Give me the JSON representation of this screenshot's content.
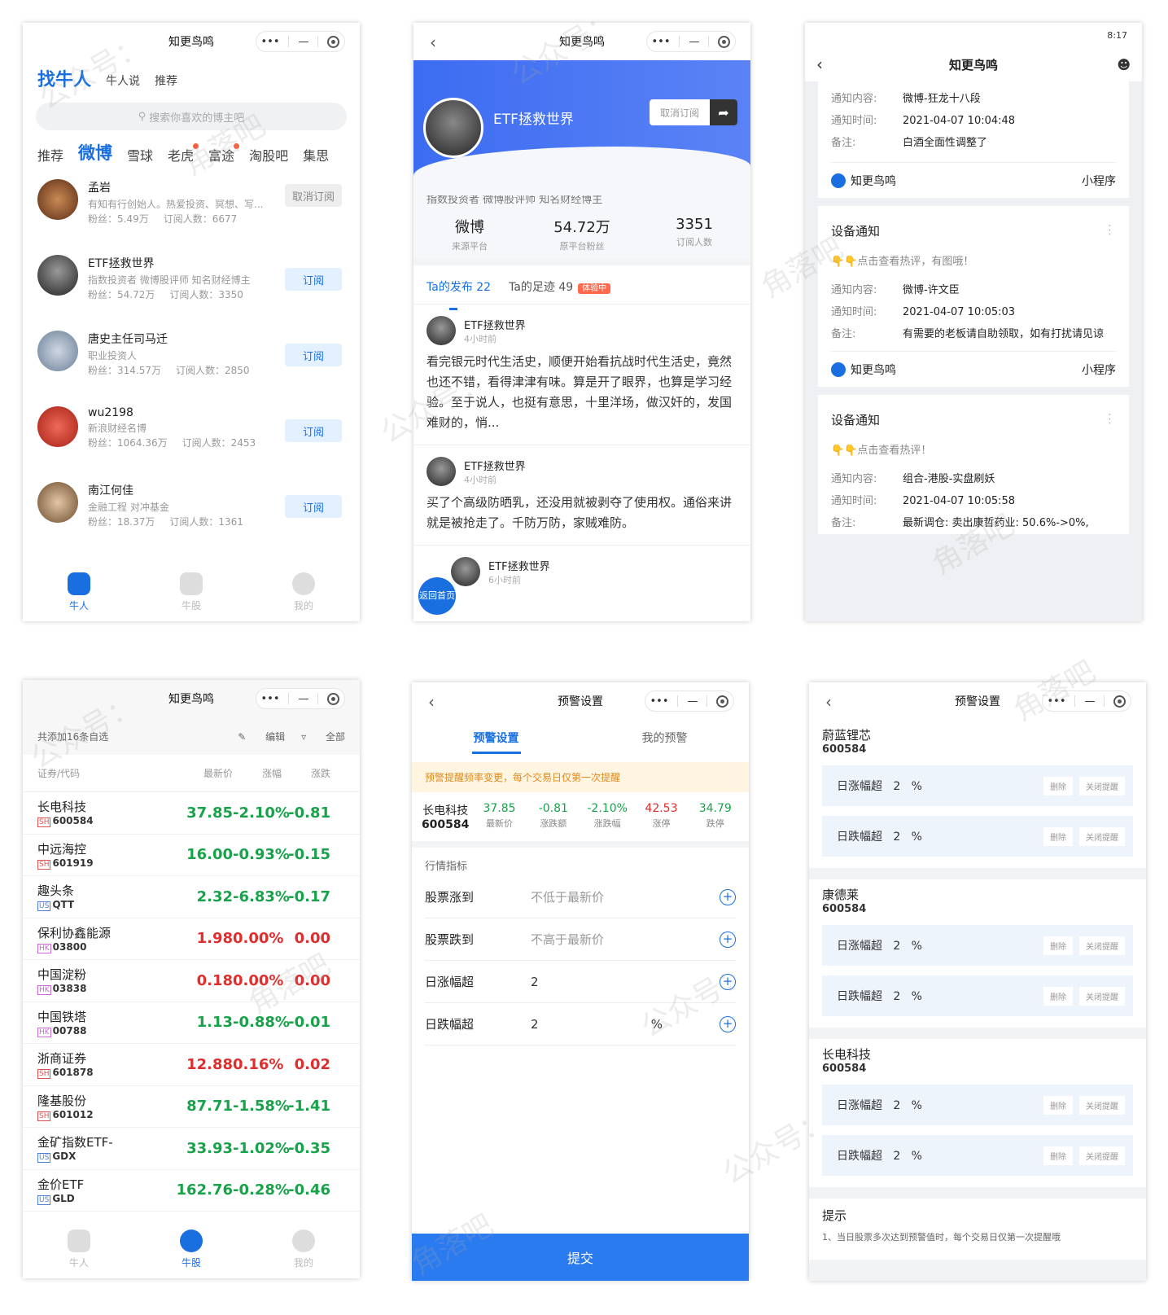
{
  "app_title": "知更鸟鸣",
  "capsule": {
    "dots": "•••",
    "minus": "—"
  },
  "p1": {
    "header": {
      "main": "找牛人",
      "tab2": "牛人说",
      "tab3": "推荐"
    },
    "search_placeholder": "搜索你喜欢的博主吧",
    "tabs": [
      "推荐",
      "微博",
      "雪球",
      "老虎",
      "富途",
      "淘股吧",
      "集思"
    ],
    "users": [
      {
        "name": "孟岩",
        "desc": "有知有行创始人。热爱投资、冥想、写...",
        "fans": "粉丝：5.49万",
        "subs": "订阅人数：6677",
        "btn": "取消订阅"
      },
      {
        "name": "ETF拯救世界",
        "desc": "指数投资者 微博股评师 知名财经博主",
        "fans": "粉丝：54.72万",
        "subs": "订阅人数：3350",
        "btn": "订阅"
      },
      {
        "name": "唐史主任司马迁",
        "desc": "职业投资人",
        "fans": "粉丝：314.57万",
        "subs": "订阅人数：2850",
        "btn": "订阅"
      },
      {
        "name": "wu2198",
        "desc": "新浪财经名博",
        "fans": "粉丝：1064.36万",
        "subs": "订阅人数：2453",
        "btn": "订阅"
      },
      {
        "name": "南江何佳",
        "desc": "金融工程 对冲基金",
        "fans": "粉丝：18.37万",
        "subs": "订阅人数：1361",
        "btn": "订阅"
      }
    ],
    "tabbar": [
      "牛人",
      "牛股",
      "我的"
    ]
  },
  "p2": {
    "name": "ETF拯救世界",
    "unsub": "取消订阅",
    "bio": "指数投资者 微博股评师 知名财经博主",
    "stats": [
      {
        "v": "微博",
        "l": "来源平台"
      },
      {
        "v": "54.72万",
        "l": "原平台粉丝"
      },
      {
        "v": "3351",
        "l": "订阅人数"
      }
    ],
    "tab_posts": "Ta的发布 22",
    "tab_trace": "Ta的足迹 49",
    "trial_tag": "体验中",
    "posts": [
      {
        "name": "ETF拯救世界",
        "time": "4小时前",
        "text": "看完银元时代生活史，顺便开始看抗战时代生活史，竟然也还不错，看得津津有味。算是开了眼界，也算是学习经验。至于说人，也挺有意思，十里洋场，做汉奸的，发国难财的，悄..."
      },
      {
        "name": "ETF拯救世界",
        "time": "4小时前",
        "text": "买了个高级防晒乳，还没用就被剥夺了使用权。通俗来讲就是被抢走了。千防万防，家贼难防。"
      },
      {
        "name": "ETF拯救世界",
        "time": "6小时前",
        "text": ""
      }
    ],
    "home_btn": "返回首页"
  },
  "p3": {
    "status_time": "8:17",
    "title": "知更鸟鸣",
    "labels": {
      "content": "通知内容:",
      "time": "通知时间:",
      "remark": "备注:"
    },
    "footer_app": "知更鸟鸣",
    "footer_mini": "小程序",
    "card0": {
      "content": "微博-狂龙十八段",
      "time": "2021-04-07 10:04:48",
      "remark": "白酒全面性调整了"
    },
    "card1": {
      "title": "设备通知",
      "hint": "👇👇点击查看热评，有图哦！",
      "content": "微博-许文臣",
      "time": "2021-04-07 10:05:03",
      "remark": "有需要的老板请自助领取，如有打扰请见谅"
    },
    "card2": {
      "title": "设备通知",
      "hint": "👇👇点击查看热评！",
      "content": "组合-港股-实盘刷妖",
      "time": "2021-04-07 10:05:58",
      "remark": "最新调仓: 卖出康哲药业: 50.6%->0%,"
    }
  },
  "p4": {
    "count": "共添加16条自选",
    "edit": "编辑",
    "all": "全部",
    "headers": [
      "证券/代码",
      "最新价",
      "涨幅",
      "涨跌"
    ],
    "rows": [
      {
        "name": "长电科技",
        "mkt": "SH",
        "code": "600584",
        "price": "37.85",
        "pct": "-2.10%",
        "chg": "-0.81",
        "dir": "dn"
      },
      {
        "name": "中远海控",
        "mkt": "SH",
        "code": "601919",
        "price": "16.00",
        "pct": "-0.93%",
        "chg": "-0.15",
        "dir": "dn"
      },
      {
        "name": "趣头条",
        "mkt": "US",
        "code": "QTT",
        "price": "2.32",
        "pct": "-6.83%",
        "chg": "-0.17",
        "dir": "dn"
      },
      {
        "name": "保利协鑫能源",
        "mkt": "HK",
        "code": "03800",
        "price": "1.98",
        "pct": "0.00%",
        "chg": "0.00",
        "dir": "up"
      },
      {
        "name": "中国淀粉",
        "mkt": "HK",
        "code": "03838",
        "price": "0.18",
        "pct": "0.00%",
        "chg": "0.00",
        "dir": "up"
      },
      {
        "name": "中国铁塔",
        "mkt": "HK",
        "code": "00788",
        "price": "1.13",
        "pct": "-0.88%",
        "chg": "-0.01",
        "dir": "dn"
      },
      {
        "name": "浙商证券",
        "mkt": "SH",
        "code": "601878",
        "price": "12.88",
        "pct": "0.16%",
        "chg": "0.02",
        "dir": "up"
      },
      {
        "name": "隆基股份",
        "mkt": "SH",
        "code": "601012",
        "price": "87.71",
        "pct": "-1.58%",
        "chg": "-1.41",
        "dir": "dn"
      },
      {
        "name": "金矿指数ETF-",
        "mkt": "US",
        "code": "GDX",
        "price": "33.93",
        "pct": "-1.02%",
        "chg": "-0.35",
        "dir": "dn"
      },
      {
        "name": "金价ETF",
        "mkt": "US",
        "code": "GLD",
        "price": "162.76",
        "pct": "-0.28%",
        "chg": "-0.46",
        "dir": "dn"
      }
    ],
    "tabbar": [
      "牛人",
      "牛股",
      "我的"
    ]
  },
  "p5": {
    "title": "预警设置",
    "tab1": "预警设置",
    "tab2": "我的预警",
    "notice": "预警提醒频率变更，每个交易日仅第一次提醒",
    "stock_name": "长电科技",
    "stock_code": "600584",
    "quote": [
      {
        "v": "37.85",
        "l": "最新价",
        "c": "dn"
      },
      {
        "v": "-0.81",
        "l": "涨跌额",
        "c": "dn"
      },
      {
        "v": "-2.10%",
        "l": "涨跌幅",
        "c": "dn"
      },
      {
        "v": "42.53",
        "l": "涨停",
        "c": "up"
      },
      {
        "v": "34.79",
        "l": "跌停",
        "c": "dn"
      }
    ],
    "section": "行情指标",
    "fields": [
      {
        "label": "股票涨到",
        "value": "不低于最新价",
        "pct": ""
      },
      {
        "label": "股票跌到",
        "value": "不高于最新价",
        "pct": ""
      },
      {
        "label": "日涨幅超",
        "value": "2",
        "pct": ""
      },
      {
        "label": "日跌幅超",
        "value": "2",
        "pct": "%"
      }
    ],
    "submit": "提交"
  },
  "p6": {
    "title": "预警设置",
    "groups": [
      {
        "name": "蔚蓝锂芯",
        "code": "600584"
      },
      {
        "name": "康德莱",
        "code": "600584"
      },
      {
        "name": "长电科技",
        "code": "600584"
      }
    ],
    "rise_label": "日涨幅超",
    "fall_label": "日跌幅超",
    "value": "2",
    "unit": "%",
    "delete": "删除",
    "close": "关闭提醒",
    "tip_title": "提示",
    "tip_text": "1、当日股票多次达到预警值时，每个交易日仅第一次提醒哦"
  },
  "watermarks": [
    "公众号：",
    "角落吧"
  ],
  "colors": {
    "brand": "#1a6fe0",
    "up": "#e02d2d",
    "down": "#17a34a"
  }
}
